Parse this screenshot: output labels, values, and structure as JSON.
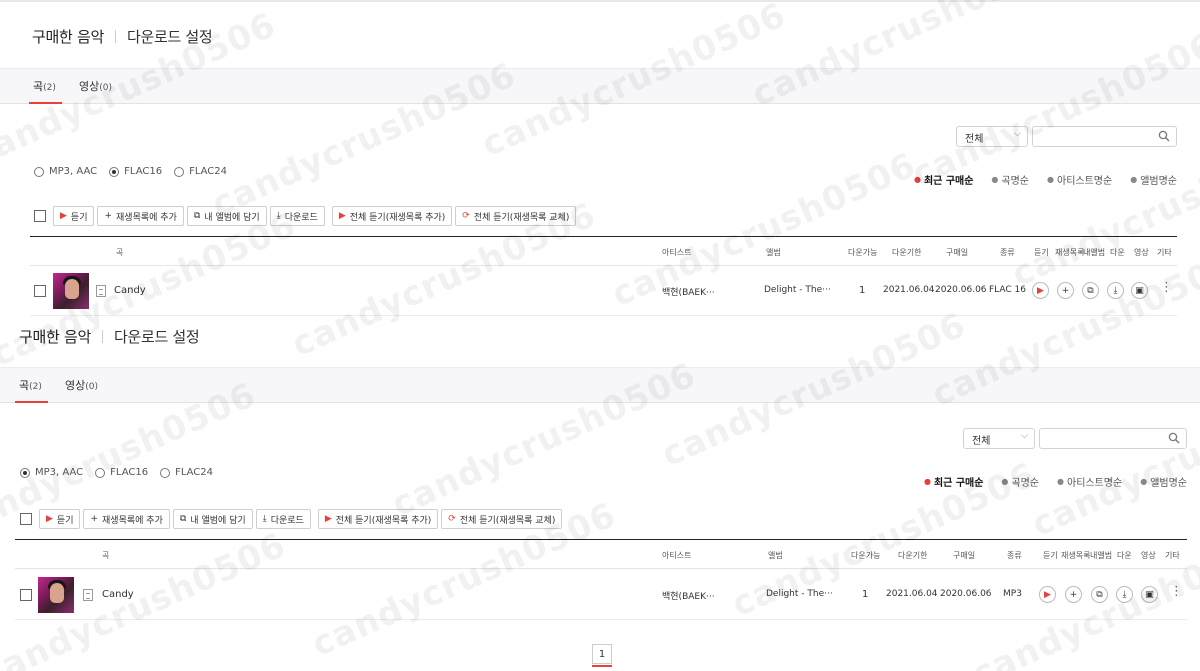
{
  "panels": [
    {
      "title": "구매한 음악",
      "subtitle": "다운로드 설정",
      "tabs": [
        {
          "label": "곡",
          "count": "(2)"
        },
        {
          "label": "영상",
          "count": "(0)"
        }
      ],
      "filter_value": "전체",
      "quality_options": [
        "MP3, AAC",
        "FLAC16",
        "FLAC24"
      ],
      "quality_selected": 1,
      "sort_options": [
        "최근 구매순",
        "곡명순",
        "아티스트명순",
        "앨범명순"
      ],
      "sort_active": 0,
      "actions": {
        "play": "듣기",
        "add_playlist": "재생목록에 추가",
        "add_album": "내 앨범에 담기",
        "download": "다운로드",
        "play_all_add": "전체 듣기(재생목록 추가)",
        "play_all_replace": "전체 듣기(재생목록 교체)"
      },
      "columns": {
        "song": "곡",
        "artist": "아티스트",
        "album": "앨범",
        "downloads": "다운가능",
        "expiry": "다운기한",
        "purchase_date": "구매일",
        "type": "종류",
        "listen": "듣기",
        "playlist": "재생목록",
        "my_album": "내앨범",
        "download": "다운",
        "video": "영상",
        "etc": "기타"
      },
      "rows": [
        {
          "song": "Candy",
          "artist": "백현(BAEK···",
          "album": "Delight - The···",
          "downloads": "1",
          "expiry": "2021.06.04",
          "purchase_date": "2020.06.06",
          "type": "FLAC 16"
        }
      ]
    },
    {
      "title": "구매한 음악",
      "subtitle": "다운로드 설정",
      "tabs": [
        {
          "label": "곡",
          "count": "(2)"
        },
        {
          "label": "영상",
          "count": "(0)"
        }
      ],
      "filter_value": "전체",
      "quality_options": [
        "MP3, AAC",
        "FLAC16",
        "FLAC24"
      ],
      "quality_selected": 0,
      "sort_options": [
        "최근 구매순",
        "곡명순",
        "아티스트명순",
        "앨범명순"
      ],
      "sort_active": 0,
      "actions": {
        "play": "듣기",
        "add_playlist": "재생목록에 추가",
        "add_album": "내 앨범에 담기",
        "download": "다운로드",
        "play_all_add": "전체 듣기(재생목록 추가)",
        "play_all_replace": "전체 듣기(재생목록 교체)"
      },
      "columns": {
        "song": "곡",
        "artist": "아티스트",
        "album": "앨범",
        "downloads": "다운가능",
        "expiry": "다운기한",
        "purchase_date": "구매일",
        "type": "종류",
        "listen": "듣기",
        "playlist": "재생목록",
        "my_album": "내앨범",
        "download": "다운",
        "video": "영상",
        "etc": "기타"
      },
      "rows": [
        {
          "song": "Candy",
          "artist": "백현(BAEK···",
          "album": "Delight - The···",
          "downloads": "1",
          "expiry": "2021.06.04",
          "purchase_date": "2020.06.06",
          "type": "MP3"
        }
      ]
    }
  ],
  "pagination": {
    "current": "1"
  },
  "watermark": "candycrush0506",
  "colors": {
    "accent": "#e8403a",
    "tab_bg": "#f7f7f9"
  }
}
